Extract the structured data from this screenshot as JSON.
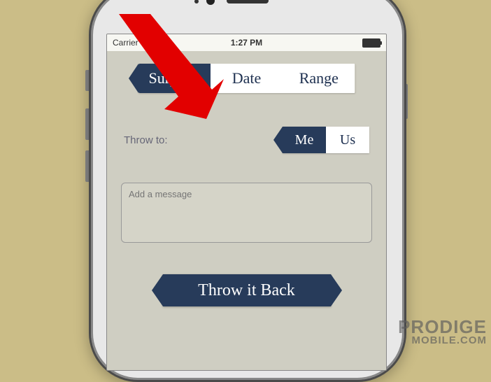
{
  "status": {
    "carrier": "Carrier",
    "time": "1:27 PM"
  },
  "mode_segment": {
    "options": [
      "Surprise",
      "Date",
      "Range"
    ],
    "selected": "Surprise"
  },
  "throw": {
    "label": "Throw to:",
    "options": [
      "Me",
      "Us"
    ],
    "selected": "Me"
  },
  "message": {
    "placeholder": "Add a message"
  },
  "action": {
    "primary": "Throw it Back"
  },
  "watermark": {
    "line1": "PRODIGE",
    "line2": "MOBILE.COM"
  }
}
